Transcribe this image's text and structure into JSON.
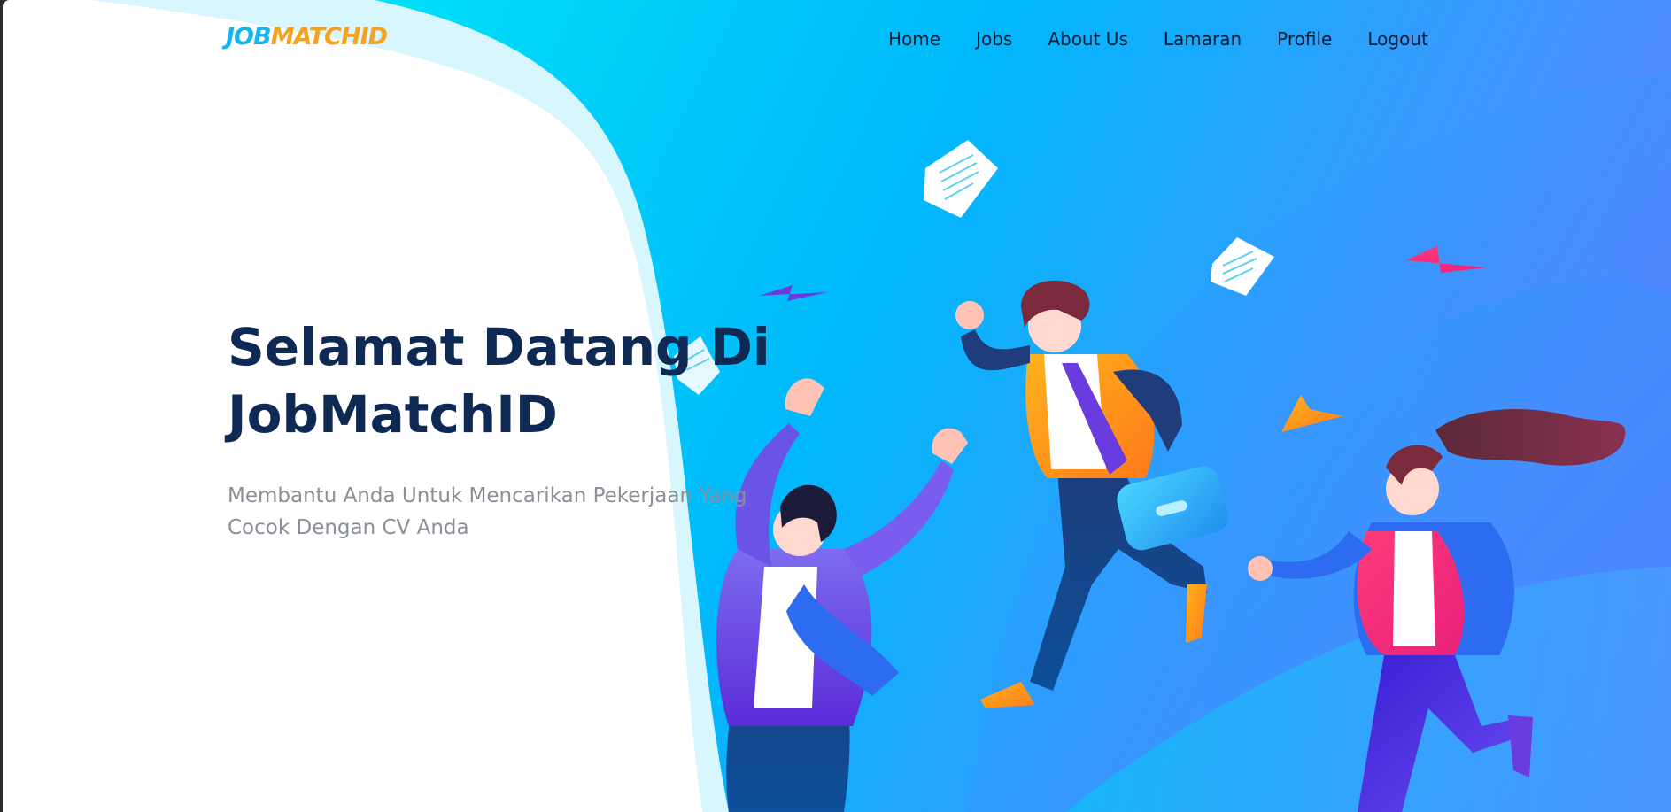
{
  "header": {
    "logo": {
      "part1": "JOB",
      "part2": "MATCHID"
    },
    "nav": [
      {
        "label": "Home"
      },
      {
        "label": "Jobs"
      },
      {
        "label": "About Us"
      },
      {
        "label": "Lamaran"
      },
      {
        "label": "Profile"
      },
      {
        "label": "Logout"
      }
    ]
  },
  "hero": {
    "title_line1": "Selamat Datang Di",
    "title_line2": "JobMatchID",
    "subtitle_line1": "Membantu Anda Untuk Mencarikan Pekerjaan Yang",
    "subtitle_line2": "Cocok Dengan CV Anda"
  },
  "colors": {
    "brand_blue": "#17b5ee",
    "brand_orange": "#f7a21c",
    "title": "#0e2a54",
    "subtitle": "#8a8f98",
    "hero_cyan": "#00d4f5",
    "hero_blue": "#4a8cff"
  },
  "illustration": {
    "icons": [
      "paper-sheet-icon",
      "paper-plane-icon",
      "briefcase-icon"
    ],
    "figures": [
      "jumping-man-figure",
      "running-businessman-figure",
      "running-woman-figure"
    ]
  }
}
